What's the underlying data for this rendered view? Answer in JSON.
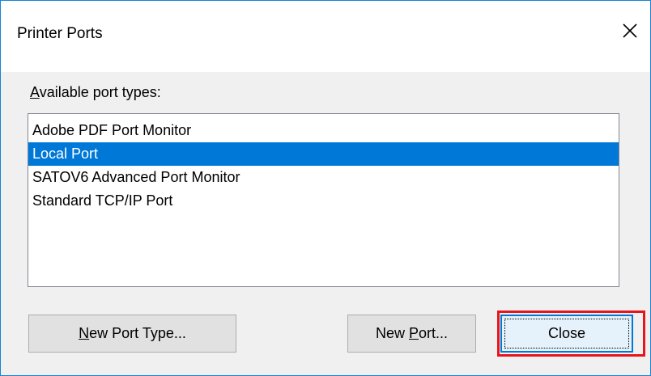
{
  "window": {
    "title": "Printer Ports"
  },
  "group": {
    "label_underlined": "A",
    "label_rest": "vailable port types:"
  },
  "port_types": [
    {
      "label": "Adobe PDF Port Monitor",
      "selected": false
    },
    {
      "label": "Local Port",
      "selected": true
    },
    {
      "label": "SATOV6 Advanced Port Monitor",
      "selected": false
    },
    {
      "label": "Standard TCP/IP Port",
      "selected": false
    }
  ],
  "buttons": {
    "new_port_type_underlined": "N",
    "new_port_type_rest": "ew Port Type...",
    "new_port_prefix": "New ",
    "new_port_underlined": "P",
    "new_port_rest": "ort...",
    "close": "Close"
  },
  "colors": {
    "selection": "#0078d7",
    "window_border": "#1883d7",
    "highlight": "#e8141b"
  },
  "icons": {
    "close": "close-icon"
  }
}
